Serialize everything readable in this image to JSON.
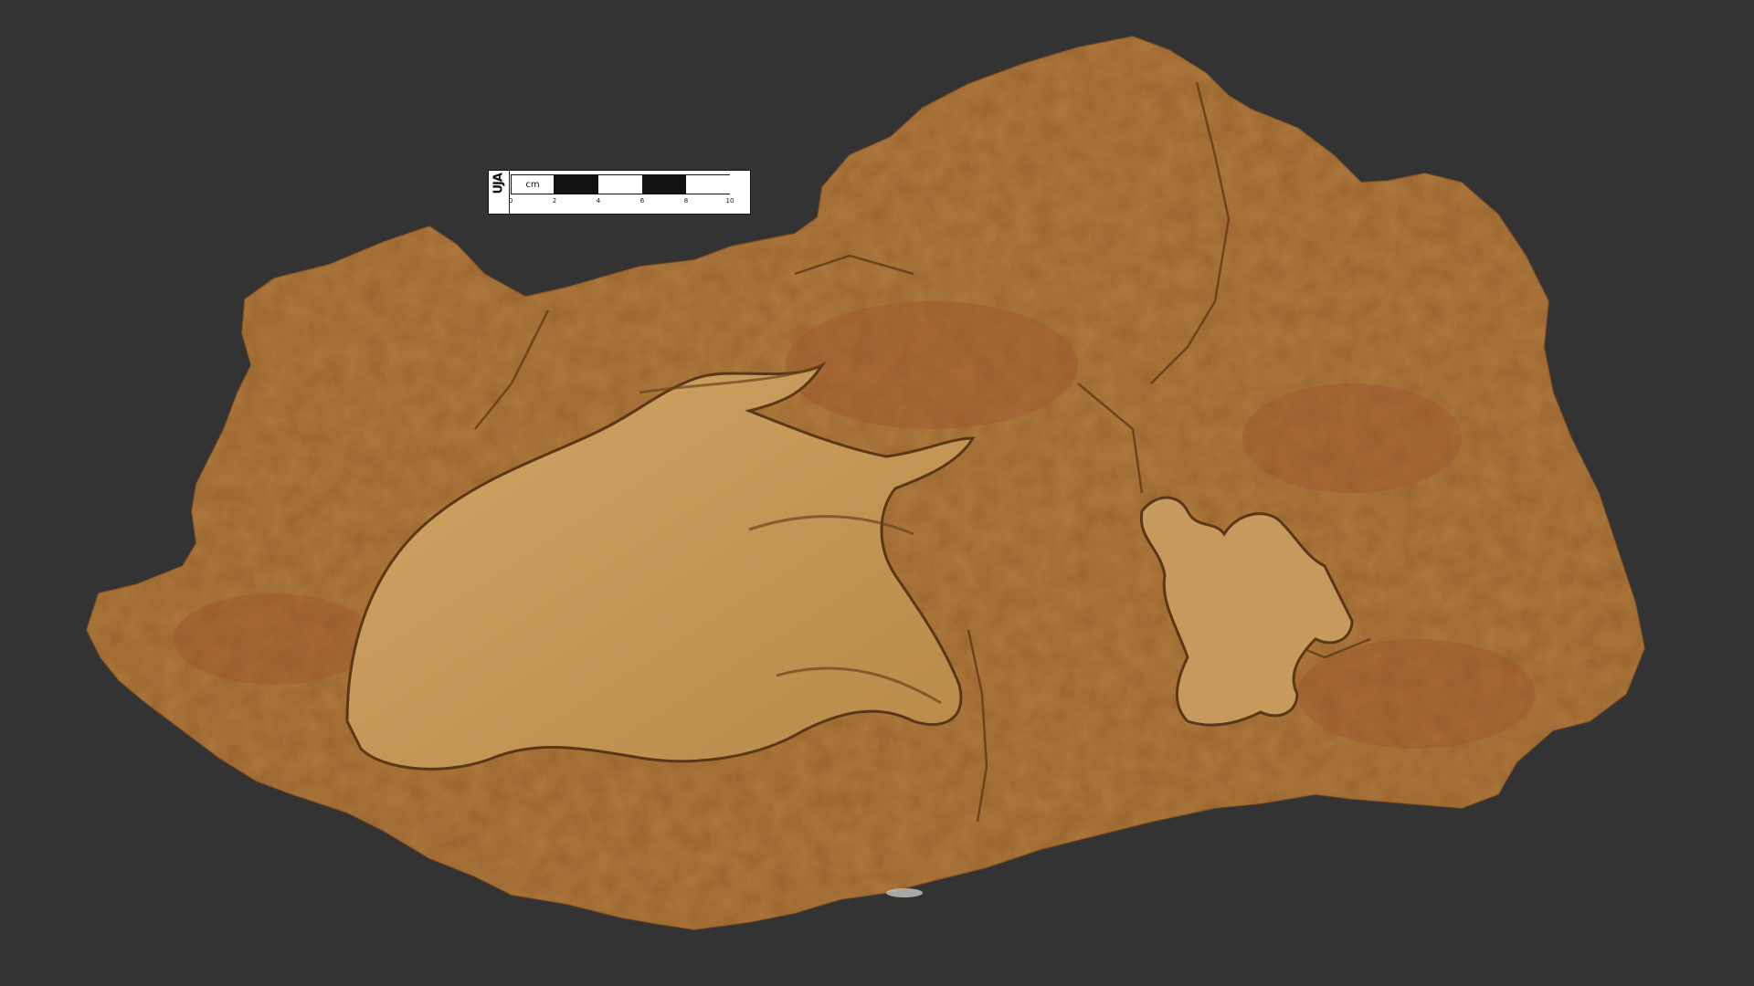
{
  "scale_bar": {
    "logo_text": "UJA",
    "unit": "cm",
    "ticks": [
      "0",
      "2",
      "4",
      "6",
      "8",
      "10"
    ]
  },
  "colors": {
    "background": "#333333",
    "rock_base": "#b5803f",
    "rock_light": "#c99a56",
    "rock_shadow": "#7a4f22"
  }
}
